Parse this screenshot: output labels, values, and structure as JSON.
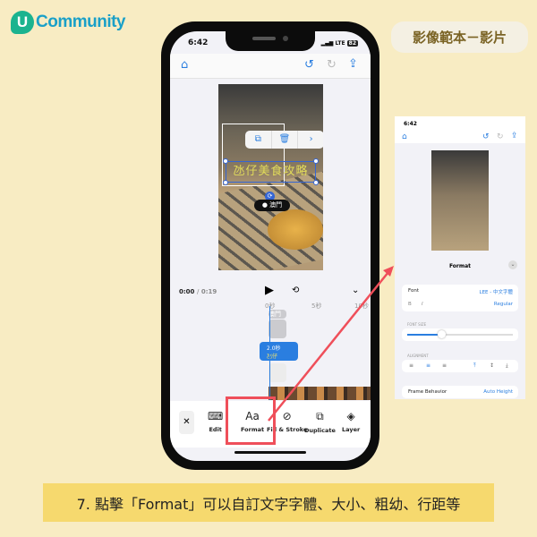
{
  "brand": {
    "logo_letter": "U",
    "logo_text": "Community"
  },
  "badge": "影像範本－影片",
  "phone": {
    "status": {
      "time": "6:42",
      "signal": "LTE",
      "battery": "82"
    },
    "nav": {
      "home_icon": "home-icon",
      "undo_icon": "undo-icon",
      "redo_icon": "redo-icon",
      "share_icon": "share-icon"
    },
    "canvas": {
      "title_text": "氹仔美食攻略",
      "location_text": "澳門",
      "context_menu": [
        "copy-icon",
        "trash-icon",
        "chevron-right-icon"
      ]
    },
    "playback": {
      "current": "0:00",
      "separator": "/",
      "total": "0:19"
    },
    "timeline": {
      "ticks": [
        "0秒",
        "5秒",
        "10秒"
      ],
      "clip_label": "2.0秒",
      "clip_text": "氹仔",
      "top_clip_text": "澳門"
    },
    "toolbar": {
      "close": "✕",
      "items": [
        {
          "label": "Edit",
          "icon": "keyboard-icon"
        },
        {
          "label": "Format",
          "icon": "Aa"
        },
        {
          "label": "Fill & Stroke",
          "icon": "fill-icon"
        },
        {
          "label": "Duplicate",
          "icon": "duplicate-icon"
        },
        {
          "label": "Layer",
          "icon": "layers-icon"
        }
      ]
    }
  },
  "preview": {
    "status_time": "6:42",
    "panel_title": "Format",
    "font_label": "Font",
    "font_value": "LEE - 中文字體",
    "bold": "B",
    "italic": "I",
    "style_value": "Regular",
    "font_size_label": "FONT SIZE",
    "font_size_fraction": 0.33,
    "alignment_label": "ALIGNMENT",
    "frame_label": "Frame Behavior",
    "frame_value": "Auto Height"
  },
  "caption": "7. 點擊「Format」可以自訂文字字體、大小、粗幼、行距等",
  "colors": {
    "background": "#f8ecc3",
    "accent_blue": "#2a7ee0",
    "highlight_red": "#ef4f5a",
    "caption_bg": "#f6d96e",
    "brand_green": "#1bb38f"
  }
}
